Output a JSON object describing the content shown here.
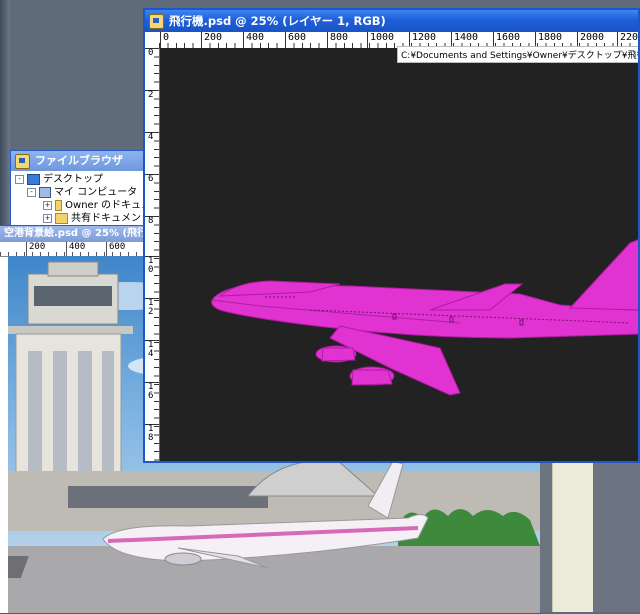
{
  "psd_window": {
    "title": "飛行機.psd @ 25% (レイヤー 1, RGB)",
    "ruler_top": [
      "0",
      "200",
      "400",
      "600",
      "800",
      "1000",
      "1200",
      "1400",
      "1600",
      "1800",
      "2000",
      "2200"
    ],
    "ruler_left": [
      "0",
      "2",
      "4",
      "6",
      "8",
      "1\n0",
      "1\n2",
      "1\n4",
      "1\n6",
      "1\n8"
    ],
    "path_tooltip": "C:¥Documents and Settings¥Owner¥デスクトップ¥飛行機¥"
  },
  "file_browser": {
    "title": "ファイルブラウザ",
    "tree": [
      {
        "expander": "-",
        "icon": "desktop-icon",
        "label": "デスクトップ"
      },
      {
        "expander": "-",
        "icon": "computer-icon",
        "label": "マイ コンピュータ"
      },
      {
        "expander": "+",
        "icon": "folder-icon",
        "label": "Owner のドキュメ"
      },
      {
        "expander": "+",
        "icon": "folder-icon",
        "label": "共有ドキュメント"
      }
    ]
  },
  "airport_window": {
    "title": "空港背景絵.psd @ 25% (飛行",
    "ruler_top": [
      "200",
      "400",
      "600"
    ]
  },
  "colors": {
    "xp_title": "#1e5fd8",
    "canvas": "#222222",
    "airplane_fill": "#e033d1"
  }
}
